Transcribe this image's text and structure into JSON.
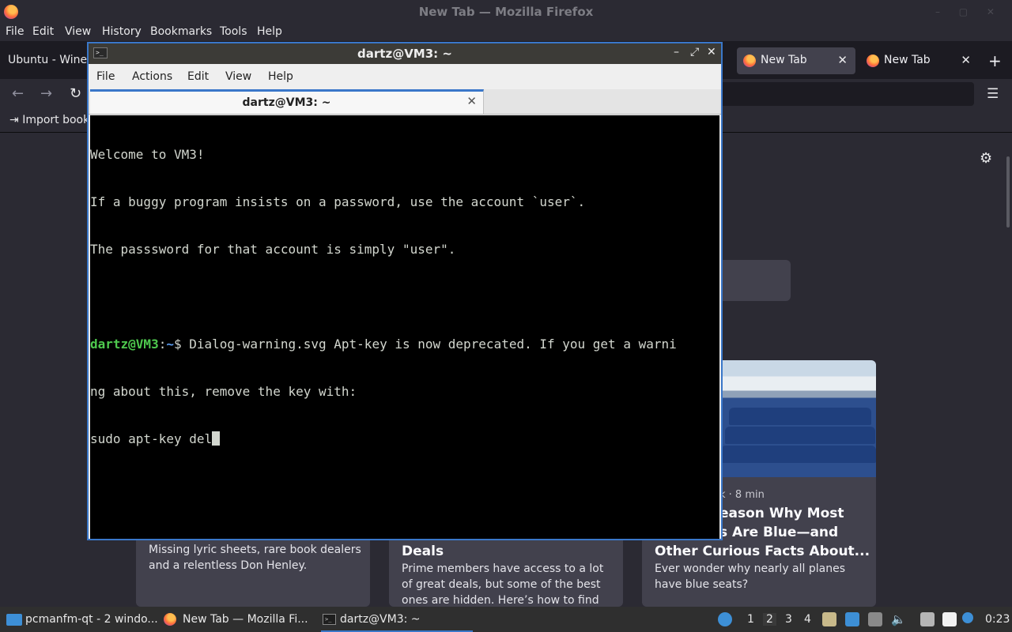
{
  "firefox": {
    "window_title": "New Tab — Mozilla Firefox",
    "menu": [
      "File",
      "Edit",
      "View",
      "History",
      "Bookmarks",
      "Tools",
      "Help"
    ],
    "tabs": [
      {
        "label": "Ubuntu - WineH",
        "active": false
      },
      {
        "label": "New Tab",
        "active": true
      },
      {
        "label": "New Tab",
        "active": false
      }
    ],
    "bookmarks_toolbar": {
      "import_label": "Import book"
    },
    "stories": [
      {
        "meta": "",
        "headline": "",
        "desc": "Missing lyric sheets, rare book dealers and a relentless Don Henley."
      },
      {
        "meta": "",
        "headline": "Deals",
        "desc": "Prime members have access to a lot of great deals, but some of the best ones are hidden. Here’s how to find them."
      },
      {
        "meta": "k · 8 min",
        "headline_lines": [
          "eason Why Most",
          "s Are Blue—and",
          "Other Curious Facts About..."
        ],
        "desc": "Ever wonder why nearly all planes have blue seats?"
      }
    ]
  },
  "terminal": {
    "window_title": "dartz@VM3: ~",
    "menu": [
      "File",
      "Actions",
      "Edit",
      "View",
      "Help"
    ],
    "tab_label": "dartz@VM3: ~",
    "lines": [
      "Welcome to VM3!",
      "If a buggy program insists on a password, use the account `user`.",
      "The passsword for that account is simply \"user\".",
      ""
    ],
    "prompt": {
      "user_host": "dartz@VM3",
      "sep": ":",
      "path": "~",
      "symbol": "$ "
    },
    "command_output": [
      "Dialog-warning.svg Apt-key is now deprecated. If you get a warni",
      "ng about this, remove the key with:",
      "sudo apt-key del"
    ]
  },
  "taskbar": {
    "tasks": [
      {
        "label": "pcmanfm-qt - 2 windo...",
        "icon": "folder-icon"
      },
      {
        "label": "New Tab — Mozilla Fi...",
        "icon": "firefox-icon"
      },
      {
        "label": "dartz@VM3: ~",
        "icon": "terminal-icon"
      }
    ],
    "workspaces": [
      "1",
      "2",
      "3",
      "4"
    ],
    "active_workspace": "2",
    "clock": "0:23"
  },
  "colors": {
    "accent": "#3a77c9",
    "prompt_user": "#4ec94e",
    "prompt_path": "#5b9cf0",
    "firefox_bg": "#2b2a33"
  }
}
